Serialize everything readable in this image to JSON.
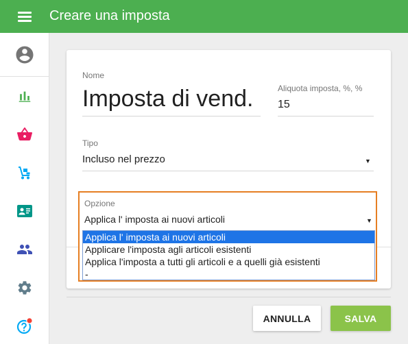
{
  "app_bar": {
    "title": "Creare una imposta",
    "menu_icon": "hamburger-menu-icon",
    "color": "#4caf50"
  },
  "sidebar": {
    "items": [
      {
        "icon": "account-circle-icon",
        "color": "#757575"
      },
      {
        "icon": "bar-chart-icon",
        "color": "#4caf50"
      },
      {
        "icon": "shopping-basket-icon",
        "color": "#e91e63"
      },
      {
        "icon": "hand-truck-icon",
        "color": "#03a9f4"
      },
      {
        "icon": "contact-card-icon",
        "color": "#009688"
      },
      {
        "icon": "people-icon",
        "color": "#3f51b5"
      },
      {
        "icon": "settings-gear-icon",
        "color": "#607d8b"
      },
      {
        "icon": "help-icon",
        "color": "#03a9f4",
        "badge_color": "#f44336"
      }
    ]
  },
  "form": {
    "name_label": "Nome",
    "name_value": "Imposta di vend.",
    "rate_label": "Aliquota imposta, %, %",
    "rate_value": "15",
    "type_label": "Tipo",
    "type_value": "Incluso nel prezzo",
    "option_label": "Opzione",
    "option_value": "Applica l' imposta ai nuovi articoli",
    "option_list": [
      "Applica l' imposta ai nuovi articoli",
      "Applicare l'imposta agli articoli esistenti",
      "Applica l'imposta a tutti gli articoli e a quelli già esistenti",
      "-"
    ],
    "selected_index": 0
  },
  "actions": {
    "cancel_label": "ANNULLA",
    "save_label": "SALVA",
    "save_color": "#8bc34a"
  }
}
